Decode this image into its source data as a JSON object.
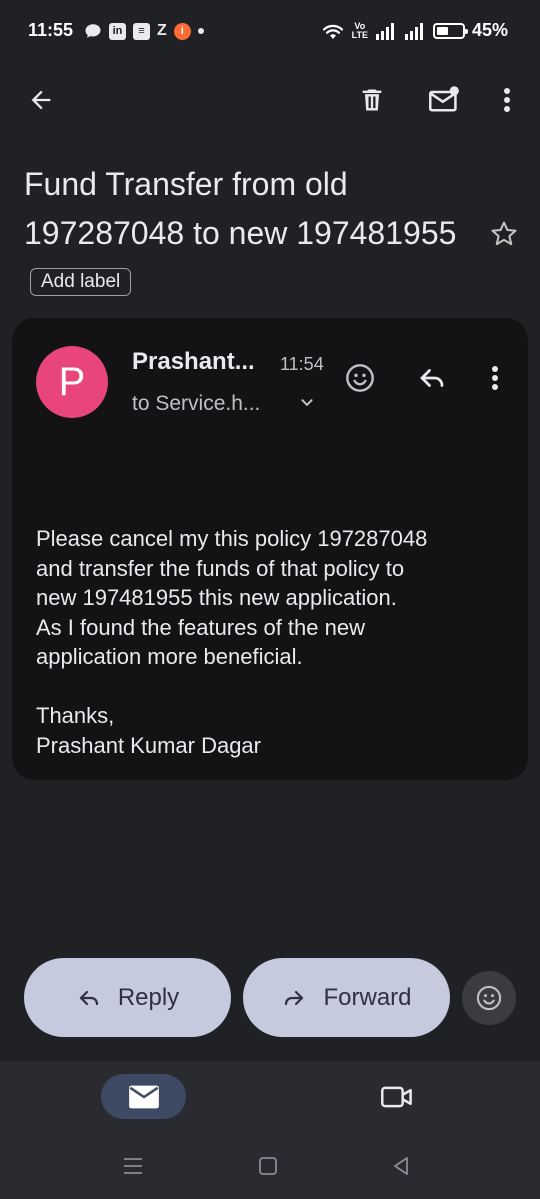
{
  "status_bar": {
    "time": "11:55",
    "notification_icons": [
      "chat-bubble-icon",
      "linkedin-icon",
      "notes-icon",
      "z-app-icon",
      "bank-app-icon",
      "more-dot-icon"
    ],
    "volte_top": "Vo",
    "volte_bottom": "LTE",
    "battery_percent": "45%"
  },
  "toolbar": {
    "back_icon": "arrow-back-icon",
    "delete_icon": "trash-icon",
    "mark_unread_icon": "mail-unread-icon",
    "more_icon": "more-vert-icon"
  },
  "email": {
    "subject": "Fund Transfer from old 197287048 to new 197481955",
    "add_label": "Add label",
    "star_icon": "star-outline-icon"
  },
  "message": {
    "avatar_letter": "P",
    "avatar_color": "#e8467a",
    "sender": "Prashant...",
    "time": "11:54",
    "recipient": "to Service.h...",
    "body": "Please cancel my this policy 197287048\nand transfer the funds of that policy to\nnew 197481955 this new application.\nAs I found the features of the new\napplication more beneficial.\n\nThanks,\nPrashant Kumar Dagar"
  },
  "actions": {
    "reply_label": "Reply",
    "forward_label": "Forward"
  },
  "bottom_nav": {
    "mail_icon": "mail-icon",
    "meet_icon": "video-camera-icon",
    "selected": "mail"
  },
  "colors": {
    "background": "#202124",
    "card": "#131316",
    "pill": "#c5cade",
    "nav_selected": "#3e4a63"
  }
}
